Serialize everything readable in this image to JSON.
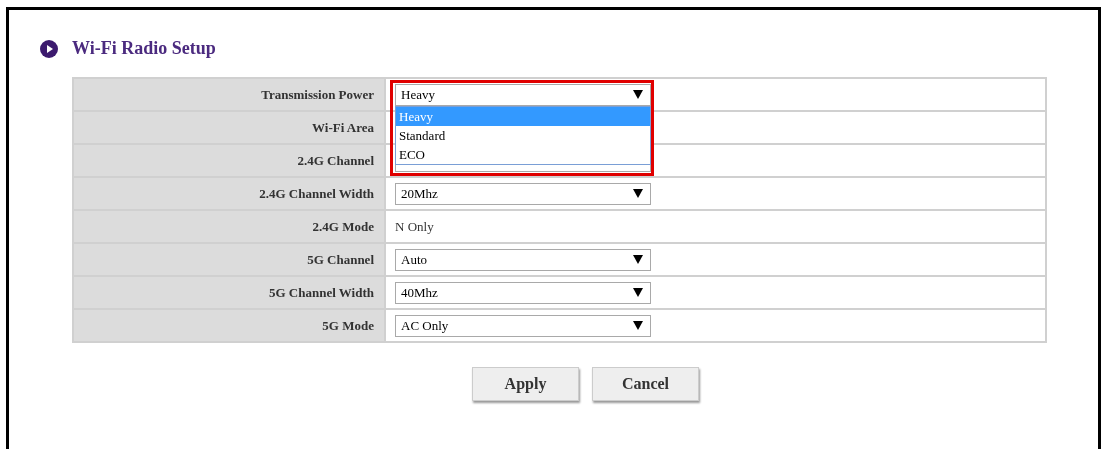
{
  "section_title": "Wi-Fi Radio Setup",
  "settings": [
    {
      "label": "Transmission Power",
      "kind": "select",
      "value": "Heavy",
      "open": true,
      "options": [
        {
          "label": "Heavy",
          "selected": true
        },
        {
          "label": "Standard",
          "selected": false
        },
        {
          "label": "ECO",
          "selected": false
        }
      ]
    },
    {
      "label": "Wi-Fi Area",
      "kind": "select"
    },
    {
      "label": "2.4G Channel",
      "kind": "select"
    },
    {
      "label": "2.4G Channel Width",
      "kind": "select",
      "value": "20Mhz"
    },
    {
      "label": "2.4G Mode",
      "kind": "text",
      "value": "N Only"
    },
    {
      "label": "5G Channel",
      "kind": "select",
      "value": "Auto"
    },
    {
      "label": "5G Channel Width",
      "kind": "select",
      "value": "40Mhz"
    },
    {
      "label": "5G Mode",
      "kind": "select",
      "value": "AC Only"
    }
  ],
  "buttons": [
    "Apply",
    "Cancel"
  ]
}
